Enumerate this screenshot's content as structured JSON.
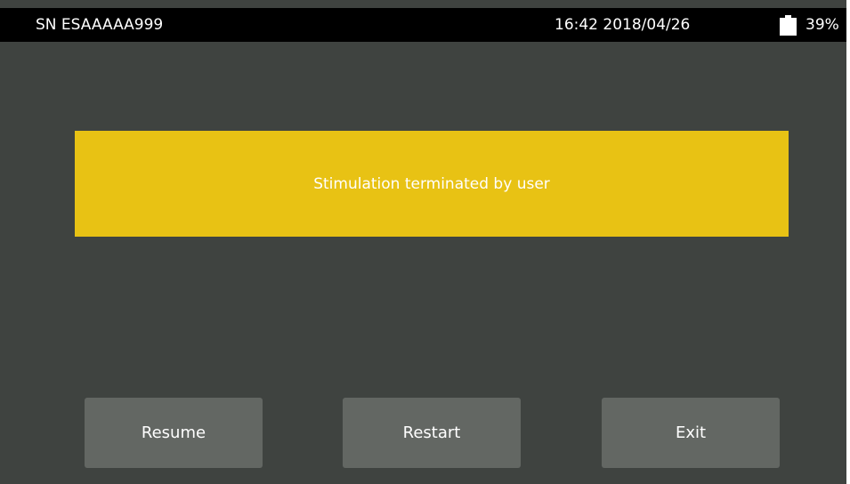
{
  "status_bar": {
    "serial": "SN ESAAAAA999",
    "datetime": "16:42 2018/04/26",
    "battery_icon": "battery-icon",
    "battery_percent": "39%"
  },
  "message": {
    "text": "Stimulation terminated by user",
    "background_color": "#e8c214"
  },
  "buttons": {
    "resume": "Resume",
    "restart": "Restart",
    "exit": "Exit"
  },
  "colors": {
    "screen_background": "#3f4340",
    "button_background": "#636763",
    "status_bar_background": "#000000"
  }
}
